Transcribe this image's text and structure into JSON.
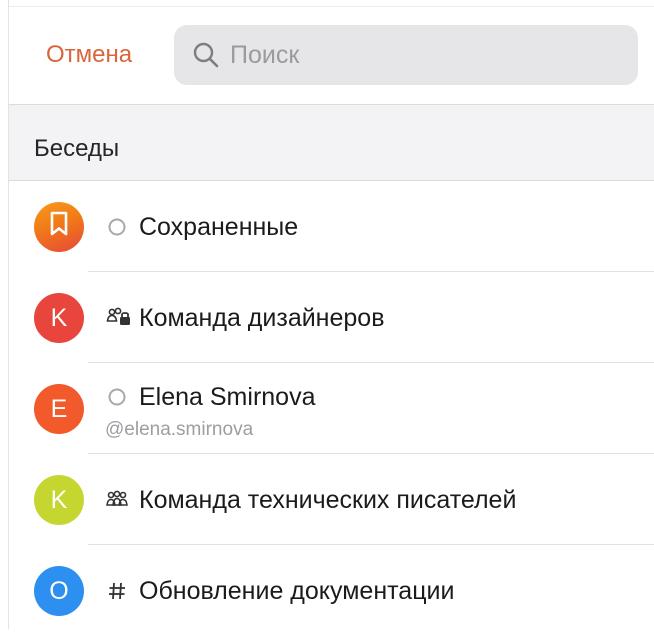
{
  "header": {
    "cancel_label": "Отмена",
    "search_placeholder": "Поиск"
  },
  "section": {
    "title": "Беседы"
  },
  "conversations": [
    {
      "title": "Сохраненные",
      "subtitle": "",
      "avatar_letter": "",
      "avatar_icon": "bookmark-icon",
      "avatar_color": "#f07a18",
      "type_icon": "status-circle-icon"
    },
    {
      "title": "Команда дизайнеров",
      "subtitle": "",
      "avatar_letter": "K",
      "avatar_icon": "",
      "avatar_color": "#e8453c",
      "type_icon": "private-group-icon"
    },
    {
      "title": "Elena Smirnova",
      "subtitle": "@elena.smirnova",
      "avatar_letter": "E",
      "avatar_icon": "",
      "avatar_color": "#f2592b",
      "type_icon": "status-circle-icon"
    },
    {
      "title": "Команда технических писателей",
      "subtitle": "",
      "avatar_letter": "K",
      "avatar_icon": "",
      "avatar_color": "#c5d630",
      "type_icon": "group-icon"
    },
    {
      "title": "Обновление документации",
      "subtitle": "",
      "avatar_letter": "O",
      "avatar_icon": "",
      "avatar_color": "#2d8ff0",
      "type_icon": "hashtag-icon"
    }
  ],
  "colors": {
    "accent": "#d9653b",
    "search_bg": "#e6e6e8",
    "section_bg": "#f3f3f5"
  }
}
